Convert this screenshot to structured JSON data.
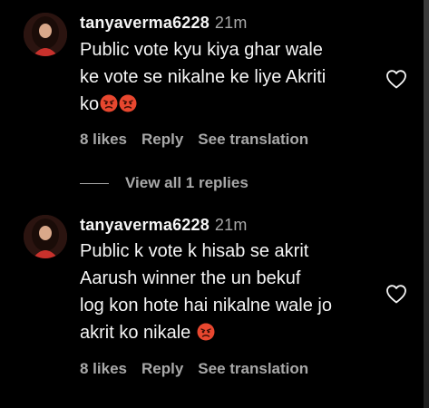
{
  "comments": [
    {
      "username": "tanyaverma6228",
      "time": "21m",
      "lines": [
        "Public vote kyu kiya ghar wale",
        "ke vote se nikalne ke liye Akriti",
        "ko"
      ],
      "likes": "8 likes",
      "reply": "Reply",
      "translate": "See translation"
    },
    {
      "username": "tanyaverma6228",
      "time": "21m",
      "lines": [
        "Public k vote k hisab se akrit",
        "Aarush winner the un bekuf",
        "log kon hote hai nikalne wale jo",
        "akrit ko nikale"
      ],
      "likes": "8 likes",
      "reply": "Reply",
      "translate": "See translation"
    }
  ],
  "view_replies": "View all 1 replies",
  "icons": {
    "heart": "heart-outline-icon",
    "emoji": "angry-face-emoji"
  },
  "colors": {
    "background": "#000000",
    "text": "#f5f5f5",
    "secondary": "#a8a8a8"
  }
}
